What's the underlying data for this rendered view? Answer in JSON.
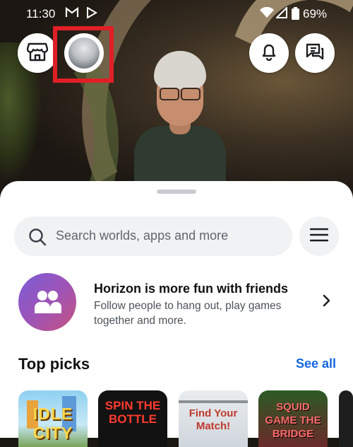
{
  "status_bar": {
    "time": "11:30",
    "battery": "69%"
  },
  "top_buttons": {
    "store": "store-icon",
    "profile": "headset-avatar",
    "notifications": "bell-icon",
    "messages": "chat-icon"
  },
  "search": {
    "placeholder": "Search worlds, apps and more"
  },
  "friends_card": {
    "title": "Horizon is more fun with friends",
    "description": "Follow people to hang out, play games together and more."
  },
  "top_picks": {
    "title": "Top picks",
    "see_all": "See all",
    "tiles": [
      {
        "name": "IDLE CITY"
      },
      {
        "name": "SPIN THE BOTTLE"
      },
      {
        "name": "Find Your Match!"
      },
      {
        "name": "SQUID GAME THE BRIDGE"
      }
    ]
  },
  "colors": {
    "accent": "#1467e0",
    "highlight": "#e01f26"
  }
}
